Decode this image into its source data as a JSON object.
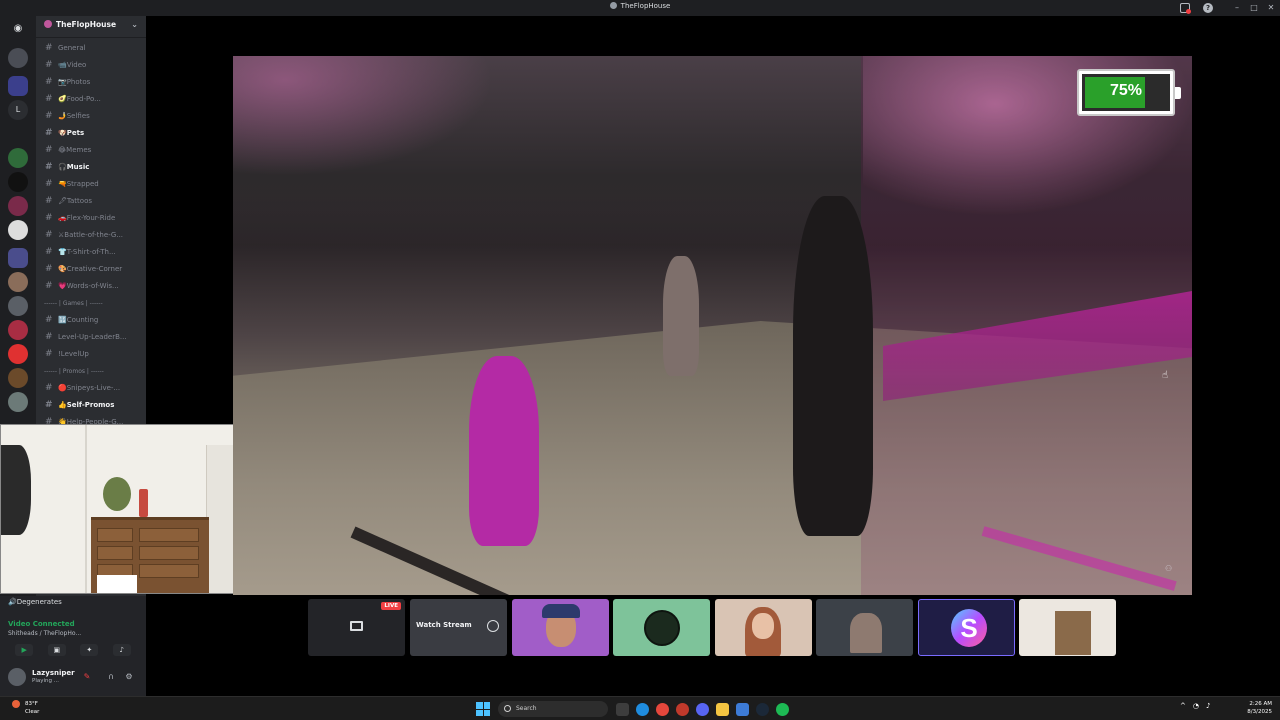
{
  "window": {
    "title": "TheFlopHouse"
  },
  "server": {
    "name": "TheFlopHouse"
  },
  "channels": [
    {
      "label": "General",
      "state": "muted"
    },
    {
      "label": "📹Video",
      "state": "muted"
    },
    {
      "label": "📷Photos",
      "state": "muted"
    },
    {
      "label": "🥑Food-Po...",
      "state": "muted"
    },
    {
      "label": "🤳Selfies",
      "state": "muted"
    },
    {
      "label": "🐶Pets",
      "state": "bold"
    },
    {
      "label": "😂Memes",
      "state": "muted"
    },
    {
      "label": "🎧Music",
      "state": "bold"
    },
    {
      "label": "🔫Strapped",
      "state": "muted"
    },
    {
      "label": "🖋Tattoos",
      "state": "muted"
    },
    {
      "label": "🚗Flex-Your-Ride",
      "state": "muted"
    },
    {
      "label": "⚔Battle-of-the-G...",
      "state": "muted"
    },
    {
      "label": "👕T-Shirt-of-Th...",
      "state": "muted"
    },
    {
      "label": "🎨Creative-Corner",
      "state": "muted"
    },
    {
      "label": "💗Words-of-Wis...",
      "state": "muted"
    }
  ],
  "category_games": "------ | Games | ------",
  "channels_games": [
    {
      "label": "🔢Counting",
      "state": "muted"
    },
    {
      "label": "Level-Up-LeaderB...",
      "state": "muted"
    },
    {
      "label": "!LevelUp",
      "state": "muted"
    }
  ],
  "category_promos": "------ | Promos | ------",
  "channels_promos": [
    {
      "label": "🔴Snipeys-Live-...",
      "state": "muted"
    },
    {
      "label": "👍Self-Promos",
      "state": "bold"
    },
    {
      "label": "👋Help-People-G...",
      "state": "muted"
    }
  ],
  "voice": {
    "channel": "🔊Degenerates",
    "connected_label": "Video Connected",
    "location": "Shitheads / TheFlopHo..."
  },
  "user": {
    "name": "Lazysniper",
    "status": "Playing ..."
  },
  "stream": {
    "battery_percent": "75%",
    "battery_level": 0.75
  },
  "tiles": {
    "live_badge": "LIVE",
    "watch_label": "Watch Stream"
  },
  "taskbar": {
    "weather_temp": "83°F",
    "weather_desc": "Clear",
    "search_placeholder": "Search",
    "time": "2:26 AM",
    "date": "8/3/2025"
  },
  "colors": {
    "accent_green": "#23a55a",
    "live_red": "#f23f43",
    "sidebar_bg": "#2b2d31"
  }
}
